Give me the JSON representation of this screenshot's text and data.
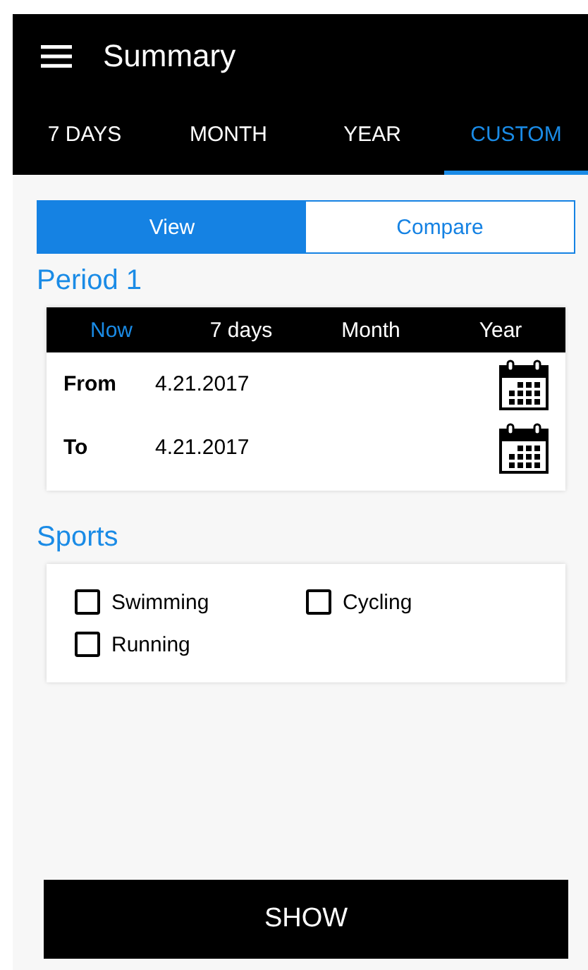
{
  "app_bar": {
    "title": "Summary"
  },
  "tabs": [
    {
      "label": "7 DAYS",
      "selected": false
    },
    {
      "label": "MONTH",
      "selected": false
    },
    {
      "label": "YEAR",
      "selected": false
    },
    {
      "label": "CUSTOM",
      "selected": true
    }
  ],
  "mode_toggle": [
    {
      "label": "View",
      "selected": true
    },
    {
      "label": "Compare",
      "selected": false
    }
  ],
  "period": {
    "heading": "Period 1",
    "ranges": [
      {
        "label": "Now",
        "selected": true
      },
      {
        "label": "7 days",
        "selected": false
      },
      {
        "label": "Month",
        "selected": false
      },
      {
        "label": "Year",
        "selected": false
      }
    ],
    "dates": [
      {
        "label": "From",
        "value": "4.21.2017"
      },
      {
        "label": "To",
        "value": "4.21.2017"
      }
    ]
  },
  "sports": {
    "heading": "Sports",
    "items": [
      {
        "label": "Swimming",
        "checked": false
      },
      {
        "label": "Cycling",
        "checked": false
      },
      {
        "label": "Running",
        "checked": false
      }
    ]
  },
  "show_button": "SHOW"
}
